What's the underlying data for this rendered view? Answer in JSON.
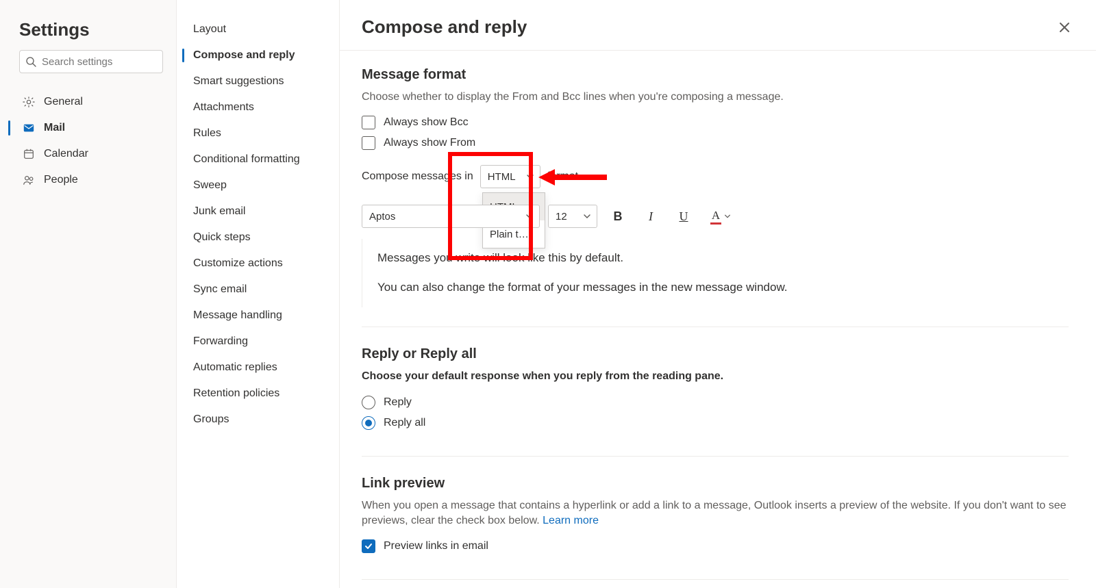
{
  "settings_title": "Settings",
  "search_placeholder": "Search settings",
  "left_nav": {
    "general": "General",
    "mail": "Mail",
    "calendar": "Calendar",
    "people": "People"
  },
  "mid_nav": {
    "layout": "Layout",
    "compose": "Compose and reply",
    "smart": "Smart suggestions",
    "attachments": "Attachments",
    "rules": "Rules",
    "conditional": "Conditional formatting",
    "sweep": "Sweep",
    "junk": "Junk email",
    "quick": "Quick steps",
    "customize": "Customize actions",
    "sync": "Sync email",
    "handling": "Message handling",
    "forwarding": "Forwarding",
    "autoreply": "Automatic replies",
    "retention": "Retention policies",
    "groups": "Groups"
  },
  "page_title": "Compose and reply",
  "msg_format": {
    "heading": "Message format",
    "desc": "Choose whether to display the From and Bcc lines when you're composing a message.",
    "always_bcc": "Always show Bcc",
    "always_from": "Always show From",
    "compose_prefix": "Compose messages in",
    "compose_suffix": "format.",
    "format_value": "HTML",
    "format_options": {
      "html": "HTML",
      "plain": "Plain t…"
    },
    "font_value": "Aptos",
    "size_value": "12",
    "preview1": "Messages you write will look like this by default.",
    "preview2": "You can also change the format of your messages in the new message window."
  },
  "reply": {
    "heading": "Reply or Reply all",
    "desc": "Choose your default response when you reply from the reading pane.",
    "reply": "Reply",
    "reply_all": "Reply all"
  },
  "link_preview": {
    "heading": "Link preview",
    "desc_a": "When you open a message that contains a hyperlink or add a link to a message, Outlook inserts a preview of the website. If you don't want to see previews, clear the check box below. ",
    "learn_more": "Learn more",
    "checkbox": "Preview links in email"
  }
}
